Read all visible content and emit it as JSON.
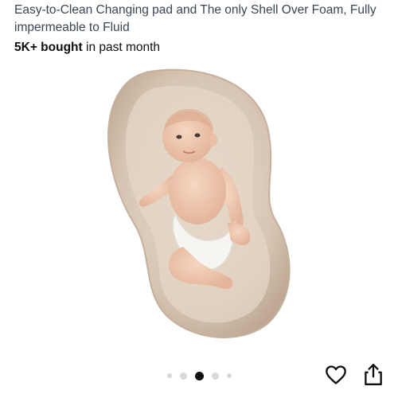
{
  "product": {
    "title": "Easy-to-Clean Changing pad and The only Shell Over Foam, Fully impermeable to Fluid",
    "bought_count": "5K+ bought",
    "bought_suffix": " in past month"
  },
  "gallery": {
    "image_description_icon": "baby-on-changing-pad-image",
    "total_images": 5,
    "active_index": 2
  },
  "actions": {
    "favorite_icon": "heart-icon",
    "share_icon": "share-icon"
  },
  "colors": {
    "pad": "#d9c8b8",
    "active_dot": "#0f1111",
    "inactive_dot": "#d5d9d9"
  }
}
